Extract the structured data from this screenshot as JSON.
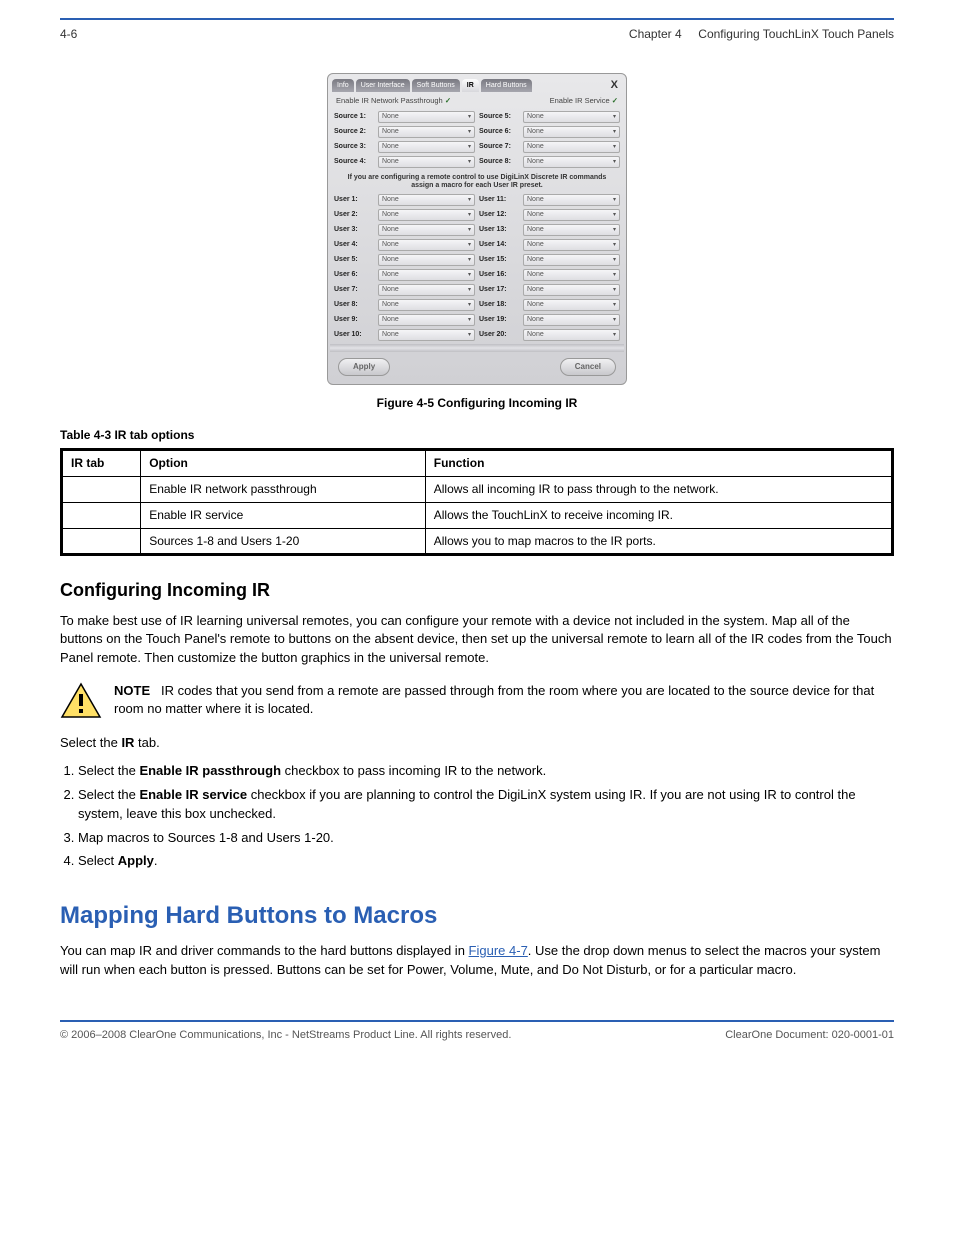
{
  "header": {
    "page_number": "4-6",
    "chapter": "Chapter 4",
    "chapter_title": "Configuring TouchLinX Touch Panels"
  },
  "screenshot": {
    "tabs": [
      "Info",
      "User Interface",
      "Soft Buttons",
      "IR",
      "Hard Buttons"
    ],
    "active_tab_index": 3,
    "close_label": "X",
    "enable_passthrough_label": "Enable IR Network Passthrough",
    "enable_service_label": "Enable IR Service",
    "sources": [
      {
        "label": "Source 1:",
        "value": "None"
      },
      {
        "label": "Source 2:",
        "value": "None"
      },
      {
        "label": "Source 3:",
        "value": "None"
      },
      {
        "label": "Source 4:",
        "value": "None"
      },
      {
        "label": "Source 5:",
        "value": "None"
      },
      {
        "label": "Source 6:",
        "value": "None"
      },
      {
        "label": "Source 7:",
        "value": "None"
      },
      {
        "label": "Source 8:",
        "value": "None"
      }
    ],
    "midtext": "If you are configuring a remote control to use DigiLinX Discrete IR commands assign a macro for each User IR preset.",
    "users_left": [
      {
        "label": "User 1:",
        "value": "None"
      },
      {
        "label": "User 2:",
        "value": "None"
      },
      {
        "label": "User 3:",
        "value": "None"
      },
      {
        "label": "User 4:",
        "value": "None"
      },
      {
        "label": "User 5:",
        "value": "None"
      },
      {
        "label": "User 6:",
        "value": "None"
      },
      {
        "label": "User 7:",
        "value": "None"
      },
      {
        "label": "User 8:",
        "value": "None"
      },
      {
        "label": "User 9:",
        "value": "None"
      },
      {
        "label": "User 10:",
        "value": "None"
      }
    ],
    "users_right": [
      {
        "label": "User 11:",
        "value": "None"
      },
      {
        "label": "User 12:",
        "value": "None"
      },
      {
        "label": "User 13:",
        "value": "None"
      },
      {
        "label": "User 14:",
        "value": "None"
      },
      {
        "label": "User 15:",
        "value": "None"
      },
      {
        "label": "User 16:",
        "value": "None"
      },
      {
        "label": "User 17:",
        "value": "None"
      },
      {
        "label": "User 18:",
        "value": "None"
      },
      {
        "label": "User 19:",
        "value": "None"
      },
      {
        "label": "User 20:",
        "value": "None"
      }
    ],
    "apply_label": "Apply",
    "cancel_label": "Cancel"
  },
  "figure_caption": "Figure 4-5 Configuring Incoming IR",
  "table_caption": "Table 4-3 IR tab options",
  "table_headers": [
    "IR tab",
    "Option",
    "Function"
  ],
  "table_rows": [
    [
      "",
      "Enable IR network passthrough",
      "Allows all incoming IR to pass through to the network."
    ],
    [
      "",
      "Enable IR service",
      "Allows the TouchLinX to receive incoming IR."
    ],
    [
      "",
      "Sources 1-8 and Users 1-20",
      "Allows you to map macros to the IR ports."
    ]
  ],
  "sections": {
    "config_heading": "Configuring Incoming IR",
    "config_para": "To make best use of IR learning universal remotes, you can configure your remote with a device not included in the system. Map all of the buttons on the Touch Panel's remote to buttons on the absent device, then set up the universal remote to learn all of the IR codes from the Touch Panel remote. Then customize the button graphics in the universal remote."
  },
  "note": {
    "text_prefix": "NOTE",
    "text_body": "IR codes that you send from a remote are passed through from the room where you are located to the source device for that room no matter where it is located."
  },
  "steps_intro_pre": "Select the ",
  "steps_intro_bold": "IR",
  "steps_intro_post": " tab.",
  "steps": {
    "s1_pre": "Select the ",
    "s1_b1": "Enable IR passthrough",
    "s1_mid": " checkbox to pass incoming IR to the network.",
    "s2_pre": "Select the ",
    "s2_b1": "Enable IR service",
    "s2_mid": " checkbox if you are planning to control the DigiLinX system using IR. If you are not using IR to control the system, leave this box unchecked.",
    "s3": "Map macros to Sources 1-8 and Users 1-20.",
    "s4_pre": "Select ",
    "s4_b1": "Apply",
    "s4_post": "."
  },
  "hardbuttons": {
    "heading": "Mapping Hard Buttons to Macros",
    "para_pre": "You can map IR and driver commands to the hard buttons displayed in ",
    "para_link": "Figure 4-7",
    "para_post": ". Use the drop down menus to select the macros your system will run when each button is pressed. Buttons can be set for Power, Volume, Mute, and Do Not Disturb, or for a particular macro."
  },
  "footer": {
    "copyright": "© 2006–2008 ClearOne Communications, Inc - NetStreams Product Line. All rights reserved.",
    "docnum": "ClearOne Document: 020-0001-01"
  }
}
